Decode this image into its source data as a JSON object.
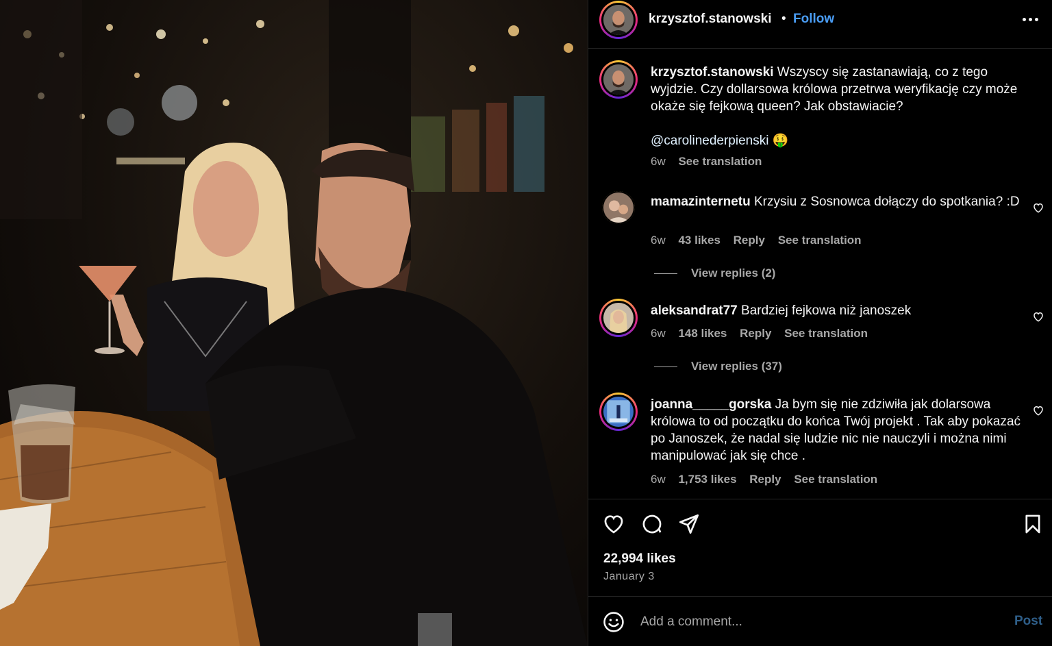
{
  "header": {
    "username": "krzysztof.stanowski",
    "separator": "•",
    "follow_label": "Follow",
    "more_icon": "more-horizontal-icon"
  },
  "caption": {
    "username": "krzysztof.stanowski",
    "text": "Wszyscy się zastanawiają, co z tego wyjdzie. Czy dollarsowa królowa przetrwa weryfikację czy może okaże się fejkową queen? Jak obstawiacie?",
    "mention": "@carolinederpienski",
    "emoji": "🤑",
    "time": "6w",
    "see_translation": "See translation"
  },
  "comments": [
    {
      "username": "mamazinternetu",
      "text": "Krzysiu z Sosnowca dołączy do spotkania? :D",
      "time": "6w",
      "likes": "43 likes",
      "reply": "Reply",
      "see_translation": "See translation",
      "view_replies": "View replies (2)"
    },
    {
      "username": "aleksandrat77",
      "text": "Bardziej fejkowa niż janoszek",
      "time": "6w",
      "likes": "148 likes",
      "reply": "Reply",
      "see_translation": "See translation",
      "view_replies": "View replies (37)"
    },
    {
      "username": "joanna_____gorska",
      "text": "Ja bym się nie zdziwiła jak dolarsowa królowa to od początku do końca Twój projekt . Tak aby pokazać po Janoszek, że nadal się ludzie nic nie nauczyli i można nimi manipulować jak się chce .",
      "time": "6w",
      "likes": "1,753 likes",
      "reply": "Reply",
      "see_translation": "See translation"
    }
  ],
  "post": {
    "likes": "22,994 likes",
    "date": "January 3"
  },
  "composer": {
    "placeholder": "Add a comment...",
    "post_label": "Post"
  },
  "colors": {
    "background": "#000000",
    "text": "#f5f5f5",
    "secondary_text": "#a8a8a8",
    "link_blue": "#4a9df5",
    "divider": "#262626"
  }
}
